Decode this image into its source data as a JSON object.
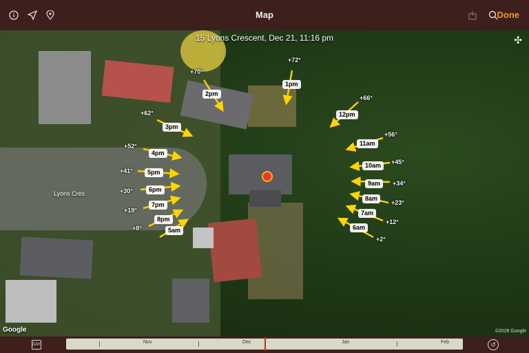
{
  "topbar": {
    "title": "Map",
    "done_label": "Done",
    "icons": [
      "info-icon",
      "location-arrow-icon",
      "pin-icon",
      "share-icon",
      "search-icon"
    ]
  },
  "map": {
    "caption": "15 Lyons Crescent, Dec 21, 11:16 pm",
    "street": "Lyons Cres",
    "google": "Google",
    "copyright": "©2026 Google",
    "hours": [
      {
        "time": "1pm",
        "deg": "+72°"
      },
      {
        "time": "2pm",
        "deg": "+70°"
      },
      {
        "time": "12pm",
        "deg": "+66°"
      },
      {
        "time": "3pm",
        "deg": "+62°"
      },
      {
        "time": "11am",
        "deg": "+56°"
      },
      {
        "time": "4pm",
        "deg": "+52°"
      },
      {
        "time": "10am",
        "deg": "+45°"
      },
      {
        "time": "5pm",
        "deg": "+41°"
      },
      {
        "time": "9am",
        "deg": "+34°"
      },
      {
        "time": "6pm",
        "deg": "+30°"
      },
      {
        "time": "8am",
        "deg": "+23°"
      },
      {
        "time": "7pm",
        "deg": "+19°"
      },
      {
        "time": "7am",
        "deg": "+12°"
      },
      {
        "time": "8pm",
        "deg": "+8°"
      },
      {
        "time": "6am",
        "deg": "+2°"
      },
      {
        "time": "5am"
      }
    ]
  },
  "bottombar": {
    "cal_label": "DAY",
    "months": [
      "Nov",
      "Dec",
      "Jan",
      "Feb"
    ]
  },
  "colors": {
    "accent": "#f09a1f",
    "bar": "#3d1f1c",
    "arrow": "#ffd400"
  }
}
